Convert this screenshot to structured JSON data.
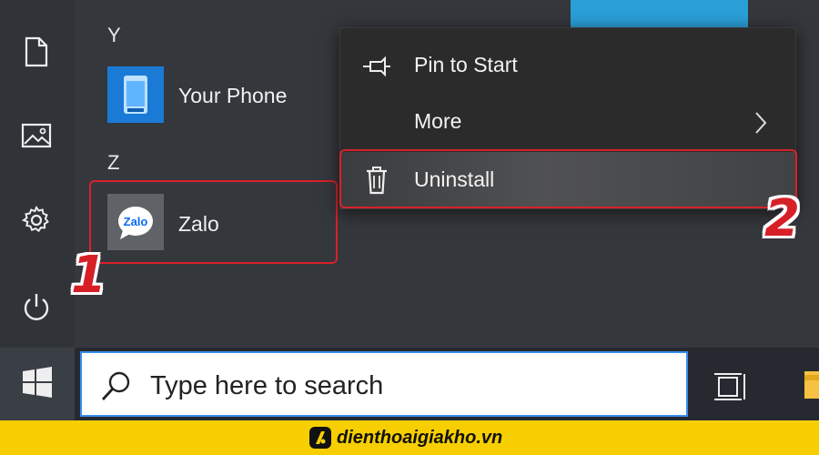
{
  "start_menu": {
    "groups": [
      {
        "letter": "Y",
        "apps": [
          {
            "name": "Your Phone",
            "icon": "your-phone-icon"
          }
        ]
      },
      {
        "letter": "Z",
        "apps": [
          {
            "name": "Zalo",
            "icon": "zalo-icon",
            "icon_text": "Zalo"
          }
        ]
      }
    ],
    "rail_icons": [
      "document-icon",
      "pictures-icon",
      "settings-gear-icon",
      "power-icon"
    ]
  },
  "context_menu": {
    "items": [
      {
        "label": "Pin to Start",
        "icon": "pin-icon"
      },
      {
        "label": "More",
        "icon": "chevron-right-icon"
      },
      {
        "label": "Uninstall",
        "icon": "trash-icon",
        "highlighted": true
      }
    ]
  },
  "annotations": {
    "step1": "1",
    "step2": "2",
    "highlight_color": "#d8212a"
  },
  "taskbar": {
    "start_icon": "windows-logo-icon",
    "search_placeholder": "Type here to search",
    "search_icon": "search-icon",
    "task_view_icon": "task-view-icon",
    "explorer_icon": "file-explorer-icon"
  },
  "footer": {
    "brand": "dienthoaigiakho.vn",
    "brand_color": "#f7cf00"
  }
}
